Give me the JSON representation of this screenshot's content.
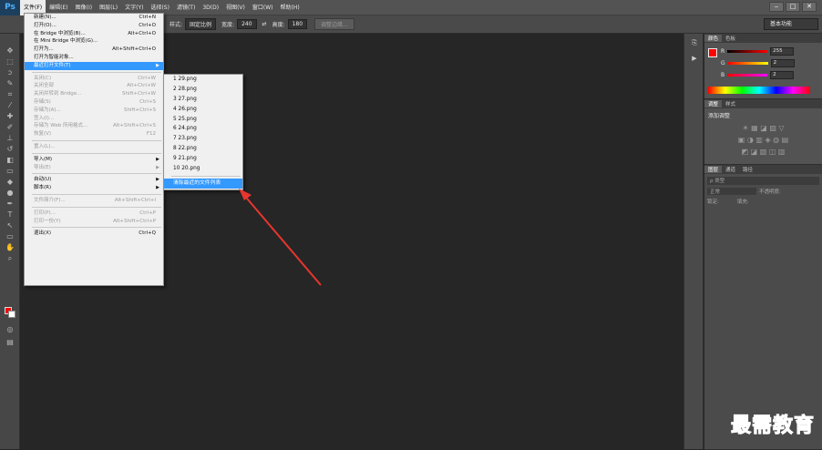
{
  "app": {
    "logo": "Ps"
  },
  "menubar": {
    "items": [
      "文件(F)",
      "编辑(E)",
      "图像(I)",
      "图层(L)",
      "文字(Y)",
      "选择(S)",
      "滤镜(T)",
      "3D(D)",
      "视图(V)",
      "窗口(W)",
      "帮助(H)"
    ]
  },
  "window_controls": {
    "minimize": "‒",
    "maximize": "□",
    "close": "✕"
  },
  "optionsbar": {
    "style_label": "样式:",
    "style_value": "固定比例",
    "width_label": "宽度:",
    "width_value": "240",
    "height_label": "高度:",
    "height_value": "180",
    "refine_edge": "调整边缘...",
    "workspace": "基本功能"
  },
  "file_menu": {
    "items": [
      {
        "label": "新建(N)...",
        "shortcut": "Ctrl+N",
        "disabled": false
      },
      {
        "label": "打开(O)...",
        "shortcut": "Ctrl+O",
        "disabled": false
      },
      {
        "label": "在 Bridge 中浏览(B)...",
        "shortcut": "Alt+Ctrl+O",
        "disabled": false
      },
      {
        "label": "在 Mini Bridge 中浏览(G)...",
        "shortcut": "",
        "disabled": false
      },
      {
        "label": "打开为...",
        "shortcut": "Alt+Shift+Ctrl+O",
        "disabled": false
      },
      {
        "label": "打开为智能对象...",
        "shortcut": "",
        "disabled": false
      },
      {
        "label": "最近打开文件(T)",
        "shortcut": "",
        "disabled": false,
        "submenu": true,
        "highlighted": true
      },
      {
        "sep": true
      },
      {
        "label": "关闭(C)",
        "shortcut": "Ctrl+W",
        "disabled": true
      },
      {
        "label": "关闭全部",
        "shortcut": "Alt+Ctrl+W",
        "disabled": true
      },
      {
        "label": "关闭并转到 Bridge...",
        "shortcut": "Shift+Ctrl+W",
        "disabled": true
      },
      {
        "label": "存储(S)",
        "shortcut": "Ctrl+S",
        "disabled": true
      },
      {
        "label": "存储为(A)...",
        "shortcut": "Shift+Ctrl+S",
        "disabled": true
      },
      {
        "label": "签入(I)...",
        "shortcut": "",
        "disabled": true
      },
      {
        "label": "存储为 Web 所用格式...",
        "shortcut": "Alt+Shift+Ctrl+S",
        "disabled": true
      },
      {
        "label": "恢复(V)",
        "shortcut": "F12",
        "disabled": true
      },
      {
        "sep": true
      },
      {
        "label": "置入(L)...",
        "shortcut": "",
        "disabled": true
      },
      {
        "sep": true
      },
      {
        "label": "导入(M)",
        "shortcut": "",
        "disabled": false,
        "submenu": true
      },
      {
        "label": "导出(E)",
        "shortcut": "",
        "disabled": true,
        "submenu": true
      },
      {
        "sep": true
      },
      {
        "label": "自动(U)",
        "shortcut": "",
        "disabled": false,
        "submenu": true
      },
      {
        "label": "脚本(R)",
        "shortcut": "",
        "disabled": false,
        "submenu": true
      },
      {
        "sep": true
      },
      {
        "label": "文件简介(F)...",
        "shortcut": "Alt+Shift+Ctrl+I",
        "disabled": true
      },
      {
        "sep": true
      },
      {
        "label": "打印(P)...",
        "shortcut": "Ctrl+P",
        "disabled": true
      },
      {
        "label": "打印一份(Y)",
        "shortcut": "Alt+Shift+Ctrl+P",
        "disabled": true
      },
      {
        "sep": true
      },
      {
        "label": "退出(X)",
        "shortcut": "Ctrl+Q",
        "disabled": false
      }
    ]
  },
  "recent_menu": {
    "files": [
      "1  29.png",
      "2  28.png",
      "3  27.png",
      "4  26.png",
      "5  25.png",
      "6  24.png",
      "7  23.png",
      "8  22.png",
      "9  21.png",
      "10  20.png"
    ],
    "clear_label": "清除最近的文件列表"
  },
  "color_panel": {
    "tabs": [
      "颜色",
      "色板"
    ],
    "r_label": "R",
    "r_value": "255",
    "g_label": "G",
    "g_value": "2",
    "b_label": "B",
    "b_value": "2",
    "fg_color": "#ff0000"
  },
  "adjust_panel": {
    "tabs": [
      "调整",
      "样式"
    ],
    "title": "添加调整"
  },
  "layers_panel": {
    "tabs": [
      "图层",
      "通道",
      "路径"
    ],
    "kind": "ρ 类型",
    "blend": "正常",
    "opacity": "不透明度:",
    "lock": "锁定:",
    "fill": "填充:"
  },
  "watermark": "最需教育"
}
